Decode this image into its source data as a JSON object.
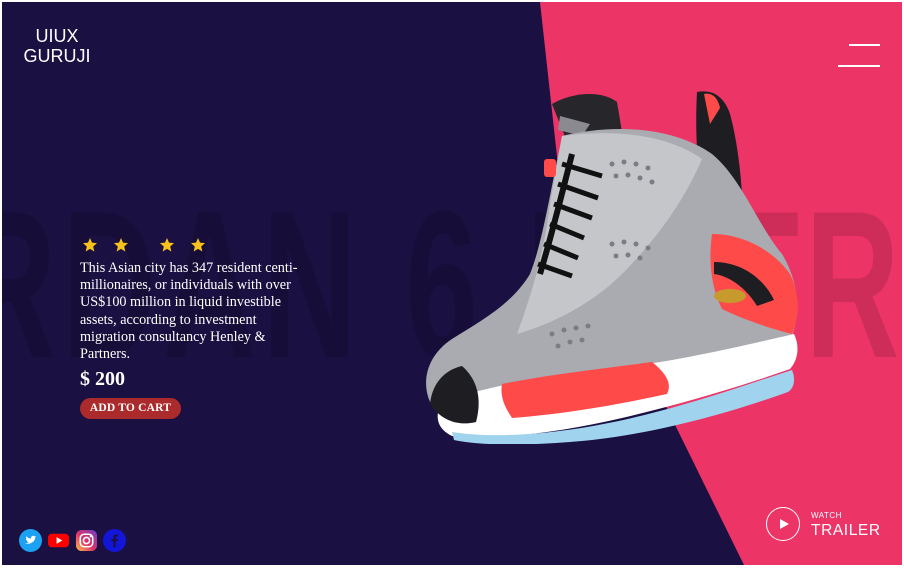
{
  "brand": {
    "line1": "UIUX",
    "line2": "GURUJI"
  },
  "background_word": "RDAN 6 RETR",
  "product": {
    "rating_stars": 4,
    "description": "This Asian city has 347 resident centi-millionaires, or individuals with over US$100 million in liquid investible assets, according to investment migration consultancy Henley & Partners.",
    "price": "$ 200",
    "add_to_cart_label": "ADD TO CART"
  },
  "trailer": {
    "watch_label": "WATCH",
    "trailer_label": "TRAILER"
  },
  "socials": [
    "twitter-icon",
    "youtube-icon",
    "instagram-icon",
    "facebook-icon"
  ],
  "colors": {
    "background": "#1b1042",
    "accent_panel": "#ec3466",
    "cart_button": "#ab2a2b",
    "star": "#f6c21b"
  }
}
